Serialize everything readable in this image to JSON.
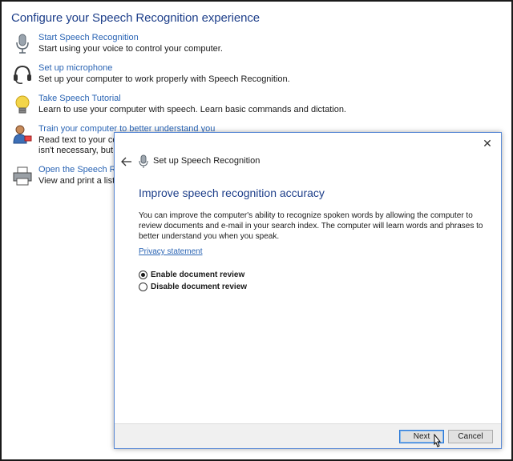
{
  "control_panel": {
    "title": "Configure your Speech Recognition experience",
    "items": [
      {
        "icon": "microphone-icon",
        "link": "Start Speech Recognition",
        "desc": "Start using your voice to control your computer.",
        "desc2": ""
      },
      {
        "icon": "headset-icon",
        "link": "Set up microphone",
        "desc": "Set up your computer to work properly with Speech Recognition.",
        "desc2": ""
      },
      {
        "icon": "lightbulb-icon",
        "link": "Take Speech Tutorial",
        "desc": "Learn to use your computer with speech.  Learn basic commands and dictation.",
        "desc2": ""
      },
      {
        "icon": "user-train-icon",
        "link": "Train your computer to better understand you",
        "desc": "Read text to your comp",
        "desc2": "isn't necessary, but car"
      },
      {
        "icon": "printer-icon",
        "link": "Open the Speech Refer",
        "desc": "View and print a list of",
        "desc2": ""
      }
    ]
  },
  "dialog": {
    "close_label": "✕",
    "title": "Set up Speech Recognition",
    "heading": "Improve speech recognition accuracy",
    "body": "You can improve the computer's ability to recognize spoken words by allowing the computer to review documents and e-mail in your search index. The computer will learn words and phrases to better understand you when you speak.",
    "privacy_link": "Privacy statement",
    "options": [
      {
        "label": "Enable document review",
        "selected": true
      },
      {
        "label": "Disable document review",
        "selected": false
      }
    ],
    "next_label": "Next",
    "cancel_label": "Cancel"
  },
  "colors": {
    "link": "#2a64b4",
    "heading": "#1e3f8a",
    "accent_border": "#5a8ad6"
  }
}
